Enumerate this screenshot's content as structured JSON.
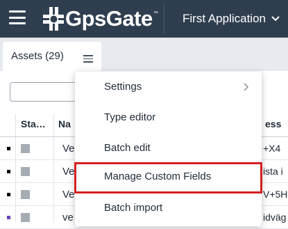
{
  "header": {
    "logo_text": "GpsGate",
    "logo_tm": "™",
    "app_name": "First Application",
    "icons": {
      "menu": "hamburger-menu-icon",
      "logo": "gpsgate-logo-icon",
      "dropdown": "chevron-down-icon"
    }
  },
  "tab": {
    "label": "Assets (29)",
    "menu_icon": "hamburger-menu-icon"
  },
  "table": {
    "columns": [
      "Sta…",
      "Na",
      "ess"
    ],
    "rows": [
      {
        "marker_color": "#000000",
        "status_color": "#a5acb4",
        "name": "Ve",
        "address": "+X4"
      },
      {
        "marker_color": "#000000",
        "status_color": "#a5acb4",
        "name": "Ve",
        "address": "ista i"
      },
      {
        "marker_color": "#000000",
        "status_color": "#a5acb4",
        "name": "Ve",
        "address": "V+5H"
      },
      {
        "marker_color": "#6a3fbf",
        "status_color": "#a5acb4",
        "name": "ve",
        "address": "idväg"
      }
    ]
  },
  "menu": {
    "items": [
      {
        "label": "Settings",
        "has_submenu": true
      },
      {
        "label": "Type editor"
      },
      {
        "label": "Batch edit"
      },
      {
        "label": "Manage Custom Fields",
        "highlighted": true
      },
      {
        "label": "Batch import"
      }
    ],
    "highlight_color": "#d42020"
  },
  "colors": {
    "header_bg": "#2f3e4f",
    "tabstrip_bg": "#e7eaee",
    "text": "#1f2a36"
  }
}
